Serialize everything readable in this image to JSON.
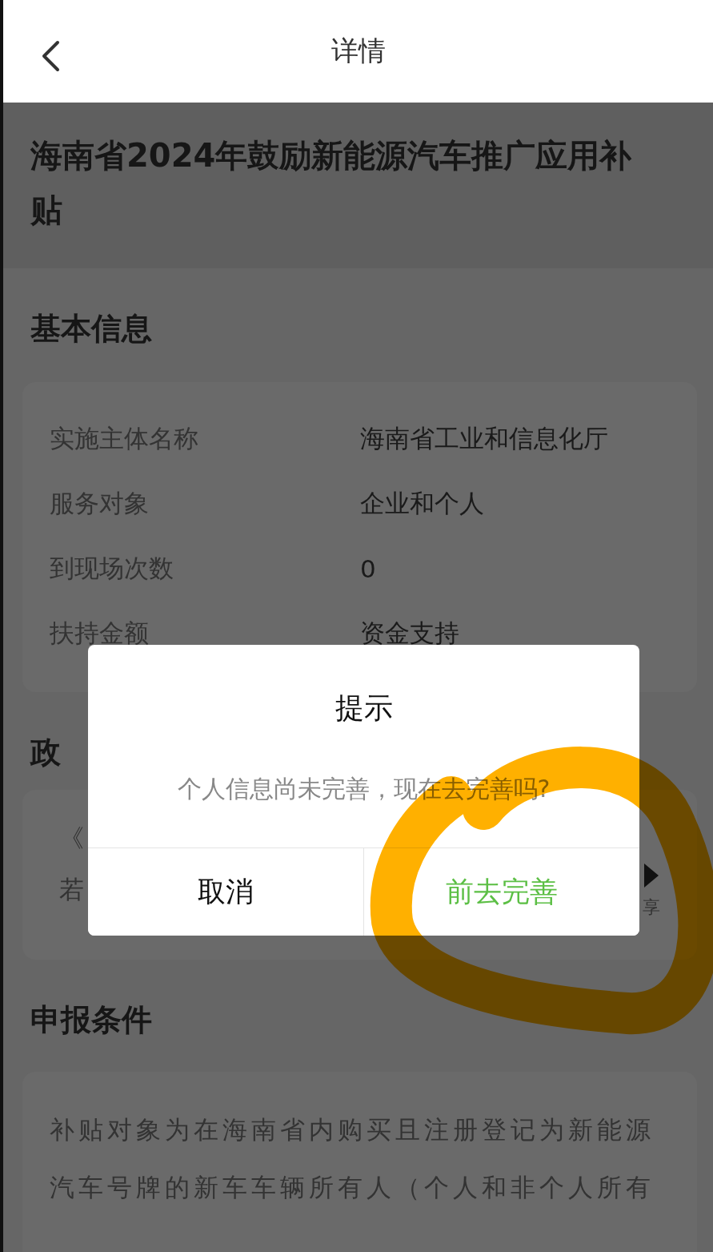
{
  "header": {
    "title": "详情"
  },
  "page_title": "海南省2024年鼓励新能源汽车推广应用补贴",
  "sections": [
    {
      "kind": "info",
      "heading": "基本信息",
      "rows": [
        {
          "label": "实施主体名称",
          "value": "海南省工业和信息化厅"
        },
        {
          "label": "服务对象",
          "value": "企业和个人"
        },
        {
          "label": "到现场次数",
          "value": "0"
        },
        {
          "label": "扶持金额",
          "value": "资金支持"
        }
      ]
    },
    {
      "kind": "policy",
      "heading": "政",
      "lines": [
        "《",
        "若"
      ],
      "share_label": "享"
    },
    {
      "kind": "text",
      "heading": "申报条件",
      "text": "补贴对象为在海南省内购买且注册登记为新能源汽车号牌的新车车辆所有人（个人和非个人所有"
    }
  ],
  "dialog": {
    "title": "提示",
    "message": "个人信息尚未完善，现在去完善吗?",
    "buttons": [
      {
        "label": "取消",
        "kind": "cancel"
      },
      {
        "label": "前去完善",
        "kind": "confirm"
      }
    ]
  },
  "annotation": {
    "kind": "highlighter"
  }
}
